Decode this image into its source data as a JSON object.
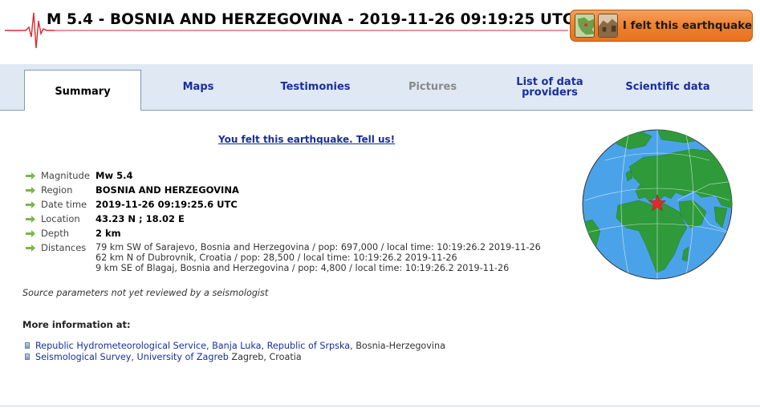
{
  "header": {
    "event_title": "M 5.4 - BOSNIA AND HERZEGOVINA - 2019-11-26 09:19:25 UTC",
    "felt_button_label": "I felt this earthquake"
  },
  "tabs": [
    {
      "label": "Summary",
      "active": true
    },
    {
      "label": "Maps"
    },
    {
      "label": "Testimonies"
    },
    {
      "label": "Pictures",
      "disabled": true
    },
    {
      "label": "List of data providers"
    },
    {
      "label": "Scientific data"
    }
  ],
  "summary": {
    "felt_link": "You felt this earthquake. Tell us!",
    "parameters": [
      {
        "label": "Magnitude",
        "value": "Mw 5.4"
      },
      {
        "label": "Region",
        "value": "BOSNIA AND HERZEGOVINA"
      },
      {
        "label": "Date time",
        "value": "2019-11-26 09:19:25.6 UTC"
      },
      {
        "label": "Location",
        "value": "43.23 N ; 18.02 E"
      },
      {
        "label": "Depth",
        "value": "2 km"
      }
    ],
    "distances_label": "Distances",
    "distances": [
      "79 km SW of Sarajevo, Bosnia and Herzegovina / pop: 697,000 / local time: 10:19:26.2 2019-11-26",
      "62 km N of Dubrovnik, Croatia / pop: 28,500 / local time: 10:19:26.2 2019-11-26",
      "9 km SE of Blagaj, Bosnia and Herzegovina / pop: 4,800 / local time: 10:19:26.2 2019-11-26"
    ],
    "source_note": "Source parameters not yet reviewed by a seismologist",
    "more_info_heading": "More information at:",
    "more_info_links": [
      {
        "parts": [
          "Republic Hydrometeorological Service",
          "Banja Luka",
          "Republic of Srpska"
        ],
        "suffix": ", Bosnia-Herzegovina"
      },
      {
        "parts": [
          "Seismological Survey",
          "University of Zagreb"
        ],
        "suffix": " Zagreb, Croatia"
      }
    ]
  },
  "colors": {
    "tab_bar": "#dfe8f3",
    "link": "#1a2f9a",
    "felt_button": "#ee7e2c",
    "arrow": "#7ab648",
    "ocean": "#4aa3e8",
    "land": "#2e9a3a",
    "epicenter": "#e8262a"
  },
  "icons": {
    "seismogram": "seismogram-icon",
    "param_bullet": "green-arrow-icon",
    "link_bullet": "square-bullet-icon",
    "epicenter": "red-star-icon"
  }
}
